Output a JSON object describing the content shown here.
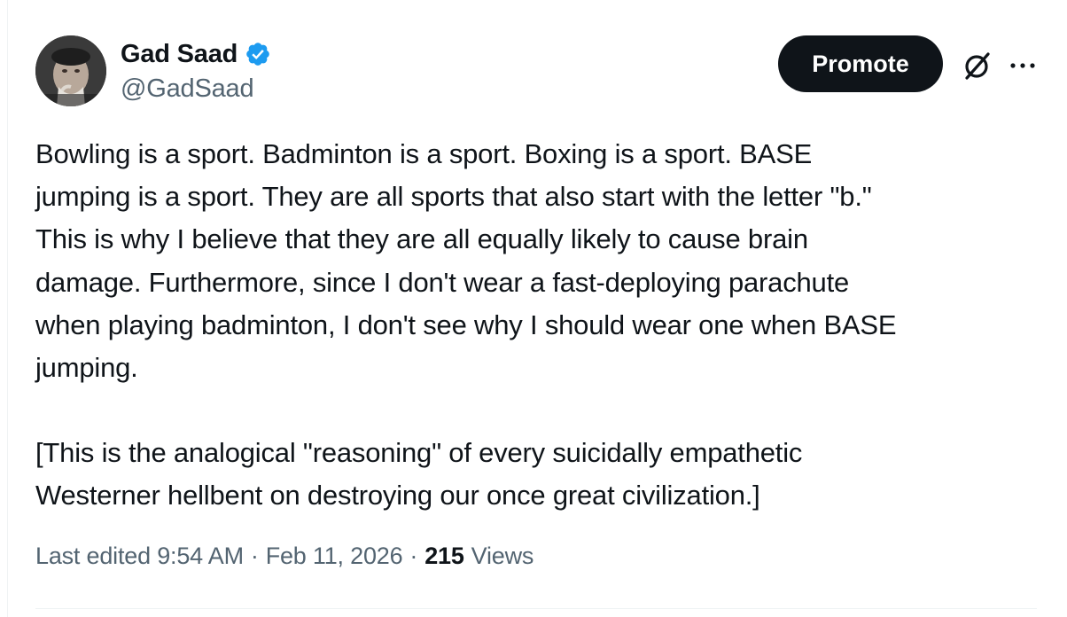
{
  "author": {
    "display_name": "Gad Saad",
    "handle": "@GadSaad",
    "verified": true,
    "avatar_icon": "profile-photo"
  },
  "actions": {
    "promote_label": "Promote",
    "grok_icon": "grok-icon",
    "more_icon": "more-horizontal-icon"
  },
  "tweet": {
    "paragraphs": [
      "Bowling is a sport.  Badminton is a sport.  Boxing is a sport.  BASE\njumping is a sport. They are all sports that also start with the letter \"b.\"\nThis is why I believe that they are all equally likely to cause brain\ndamage.  Furthermore, since I don't wear a fast-deploying parachute\nwhen playing badminton, I don't see why I should wear one when BASE\njumping.",
      "[This is the analogical \"reasoning\" of every suicidally empathetic\nWesterner hellbent on destroying our once great civilization.]"
    ]
  },
  "meta": {
    "edited_label": "Last edited",
    "time": "9:54 AM",
    "separator": "·",
    "date": "Feb 11, 2026",
    "views_count": "215",
    "views_label": "Views"
  },
  "colors": {
    "text_primary": "#0f1419",
    "text_secondary": "#536471",
    "verified_blue": "#1d9bf0",
    "button_bg": "#0f1419"
  }
}
